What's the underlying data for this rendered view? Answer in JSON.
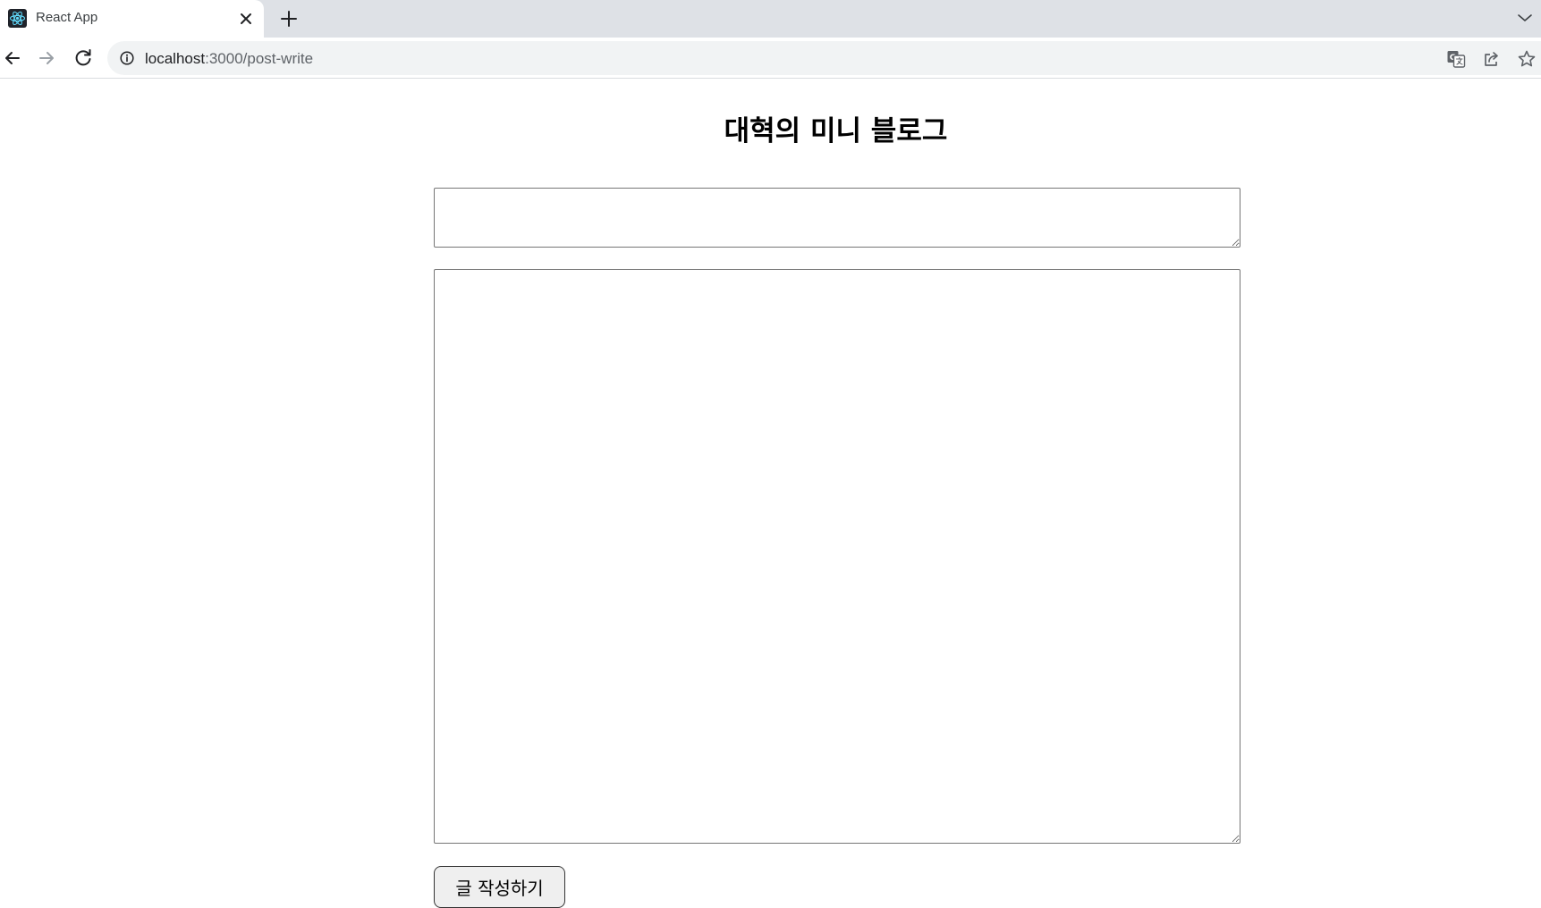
{
  "browser": {
    "tab": {
      "title": "React App",
      "favicon": "react-logo-icon"
    },
    "address_bar": {
      "url_host": "localhost",
      "url_path": ":3000/post-write"
    },
    "icons": {
      "back": "arrow-left-icon",
      "forward": "arrow-right-icon",
      "reload": "reload-icon",
      "info": "info-icon",
      "translate": "translate-icon",
      "share": "share-icon",
      "bookmark": "star-icon",
      "new_tab": "plus-icon",
      "close_tab": "close-icon",
      "tab_search": "chevron-down-icon"
    }
  },
  "page": {
    "heading": "대혁의 미니 블로그",
    "title_input": {
      "value": "",
      "placeholder": ""
    },
    "content_input": {
      "value": "",
      "placeholder": ""
    },
    "submit_label": "글 작성하기"
  },
  "colors": {
    "tabstrip_bg": "#dee1e6",
    "omnibox_bg": "#f1f3f4",
    "react_blue": "#61dafb",
    "button_bg": "#efefef"
  }
}
